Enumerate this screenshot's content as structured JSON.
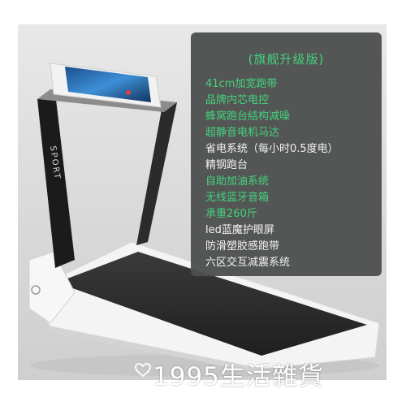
{
  "product": {
    "brand_label": "SPORT",
    "colors": {
      "frame": "#1a1a1a",
      "body": "#f4f4f4",
      "belt": "#2b2b2b",
      "accent": "#e33c3c"
    }
  },
  "specs": {
    "edition": "(旗舰升级版)",
    "items": [
      {
        "text": "41cm加宽跑带",
        "style": "accent"
      },
      {
        "text": "品牌内芯电控",
        "style": "accent"
      },
      {
        "text": "蜂窝跑台结构减噪",
        "style": "accent"
      },
      {
        "text": "超静音电机马达",
        "style": "accent"
      },
      {
        "text": "省电系统（每小时0.5度电）",
        "style": "plain"
      },
      {
        "text": "精钢跑台",
        "style": "plain"
      },
      {
        "text": "自助加油系统",
        "style": "accent"
      },
      {
        "text": "无线蓝牙音箱",
        "style": "accent"
      },
      {
        "text": "承重260斤",
        "style": "accent"
      },
      {
        "text": "led蓝魔护眼屏",
        "style": "plain"
      },
      {
        "text": "防滑塑胶感跑带",
        "style": "plain"
      },
      {
        "text": "六区交互减震系统",
        "style": "plain"
      }
    ],
    "colors": {
      "panel": "#4e5050",
      "accent_text": "#43d27a",
      "plain_text": "#f2f2f2"
    }
  },
  "watermark": {
    "icon": "heart-outline-icon",
    "text": "1995生活雜貨"
  }
}
